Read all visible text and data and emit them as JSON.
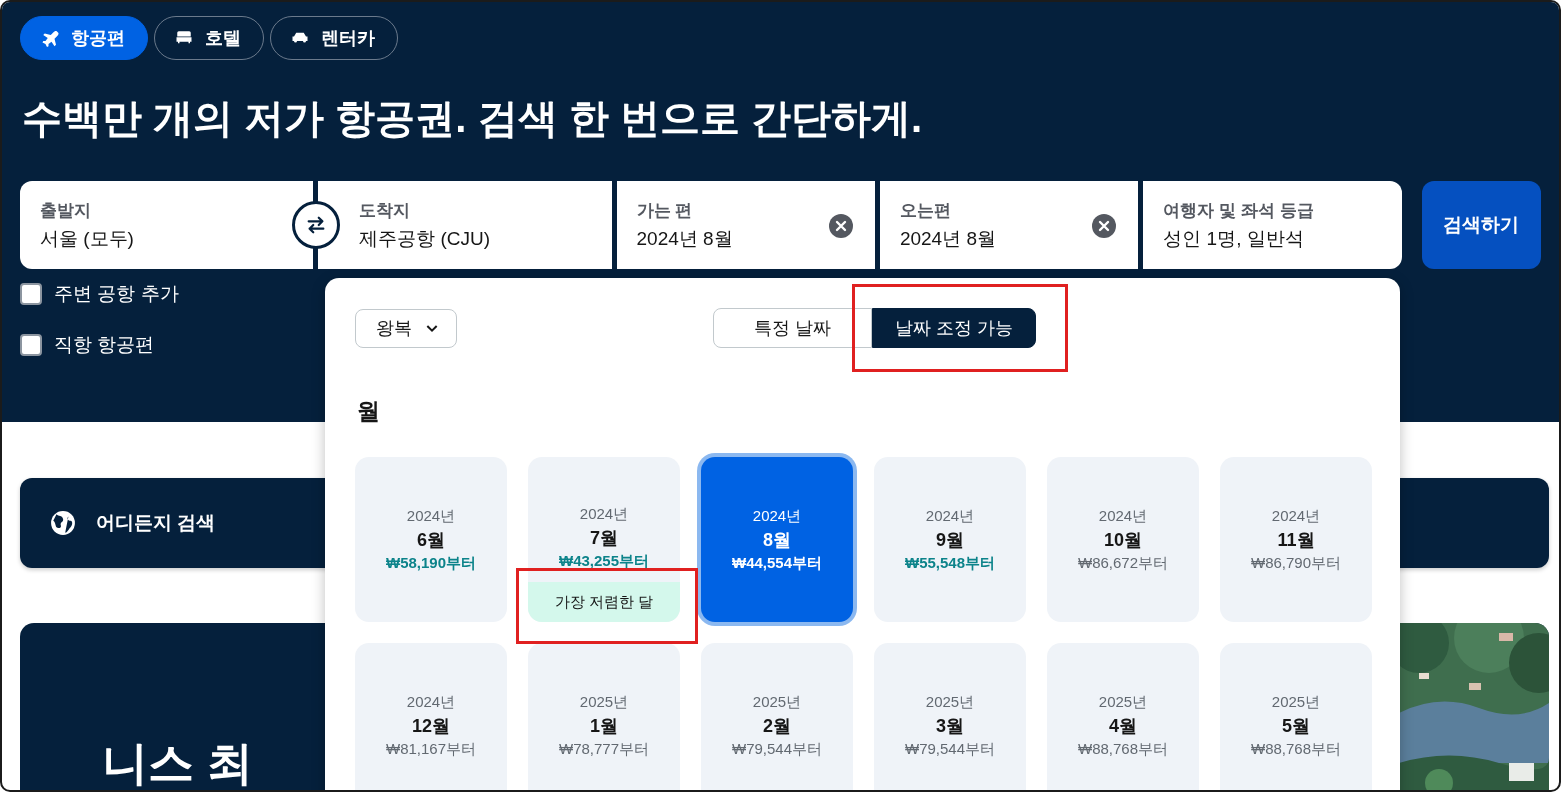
{
  "tabs": [
    {
      "label": "항공편",
      "selected": true
    },
    {
      "label": "호텔",
      "selected": false
    },
    {
      "label": "렌터카",
      "selected": false
    }
  ],
  "headline": "수백만 개의 저가 항공권. 검색 한 번으로 간단하게.",
  "search": {
    "fields": [
      {
        "label": "출발지",
        "value": "서울 (모두)",
        "clearable": false
      },
      {
        "label": "도착지",
        "value": "제주공항 (CJU)",
        "clearable": false
      },
      {
        "label": "가는 편",
        "value": "2024년 8월",
        "clearable": true
      },
      {
        "label": "오는편",
        "value": "2024년 8월",
        "clearable": true
      },
      {
        "label": "여행자 및 좌석 등급",
        "value": "성인 1명, 일반석",
        "clearable": false
      }
    ],
    "button": "검색하기"
  },
  "options": [
    {
      "label": "주변 공항 추가",
      "checked": false
    },
    {
      "label": "직항 항공편",
      "checked": false
    }
  ],
  "explore": {
    "label": "어디든지 검색"
  },
  "promo": {
    "title": "니스 최"
  },
  "date_panel": {
    "trip_type": "왕복",
    "modes": [
      {
        "label": "특정 날짜",
        "selected": false,
        "highlighted": false
      },
      {
        "label": "날짜 조정 가능",
        "selected": true,
        "highlighted": true
      }
    ],
    "heading": "월",
    "months": [
      {
        "year": "2024년",
        "month": "6월",
        "price": "₩58,190부터",
        "price_highlighted": true,
        "selected": false
      },
      {
        "year": "2024년",
        "month": "7월",
        "price": "₩43,255부터",
        "price_highlighted": true,
        "selected": false,
        "badge": {
          "label": "가장 저렴한 달",
          "highlighted": true
        }
      },
      {
        "year": "2024년",
        "month": "8월",
        "price": "₩44,554부터",
        "price_highlighted": true,
        "selected": true
      },
      {
        "year": "2024년",
        "month": "9월",
        "price": "₩55,548부터",
        "price_highlighted": true,
        "selected": false
      },
      {
        "year": "2024년",
        "month": "10월",
        "price": "₩86,672부터",
        "price_highlighted": false,
        "selected": false
      },
      {
        "year": "2024년",
        "month": "11월",
        "price": "₩86,790부터",
        "price_highlighted": false,
        "selected": false
      },
      {
        "year": "2024년",
        "month": "12월",
        "price": "₩81,167부터",
        "price_highlighted": false,
        "selected": false
      },
      {
        "year": "2025년",
        "month": "1월",
        "price": "₩78,777부터",
        "price_highlighted": false,
        "selected": false
      },
      {
        "year": "2025년",
        "month": "2월",
        "price": "₩79,544부터",
        "price_highlighted": false,
        "selected": false
      },
      {
        "year": "2025년",
        "month": "3월",
        "price": "₩79,544부터",
        "price_highlighted": false,
        "selected": false
      },
      {
        "year": "2025년",
        "month": "4월",
        "price": "₩88,768부터",
        "price_highlighted": false,
        "selected": false
      },
      {
        "year": "2025년",
        "month": "5월",
        "price": "₩88,768부터",
        "price_highlighted": false,
        "selected": false
      }
    ]
  }
}
